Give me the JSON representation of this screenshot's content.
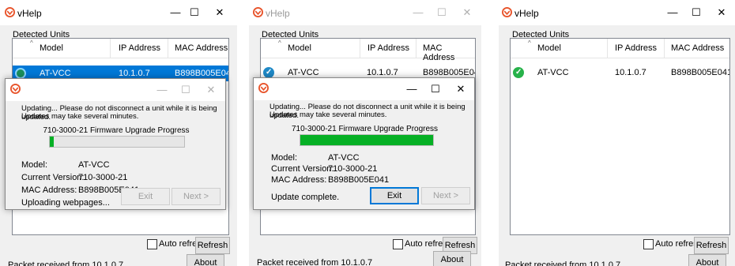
{
  "app_title": "vHelp",
  "group_label": "Detected Units",
  "columns": {
    "model": "Model",
    "ip": "IP Address",
    "mac": "MAC Address"
  },
  "unit": {
    "model": "AT-VCC",
    "ip": "10.1.0.7",
    "mac": "B898B005E041"
  },
  "checkbox_label": "Auto refresh",
  "refresh_button": "Refresh",
  "about_button": "About",
  "status_bar": "Packet received from 10.1.0.7",
  "dialog": {
    "message_line1": "Updating... Please do not disconnect a unit while it is being updated.",
    "message_line2": "Updates may take several minutes.",
    "progress_title": "710-3000-21 Firmware Upgrade Progress",
    "model_label": "Model:",
    "version_label": "Current Version:",
    "version_value": "710-3000-21",
    "mac_label": "MAC Address:",
    "exit_button": "Exit",
    "next_button": "Next >"
  },
  "panels": [
    {
      "progress": 0.03,
      "status_text": "Uploading webpages..."
    },
    {
      "progress": 1.0,
      "status_text": "Update complete."
    },
    {}
  ],
  "window_controls": {
    "minimize": "—",
    "maximize": "☐",
    "close": "✕"
  },
  "icons": {
    "app": "vhelp-logo-icon",
    "status_ok": "check-circle-icon",
    "status_busy": "spinner-icon"
  },
  "colors": {
    "selection": "#0078d7",
    "progress": "#06b025",
    "ok_green": "#27b24a",
    "logo": "#e8542b"
  }
}
